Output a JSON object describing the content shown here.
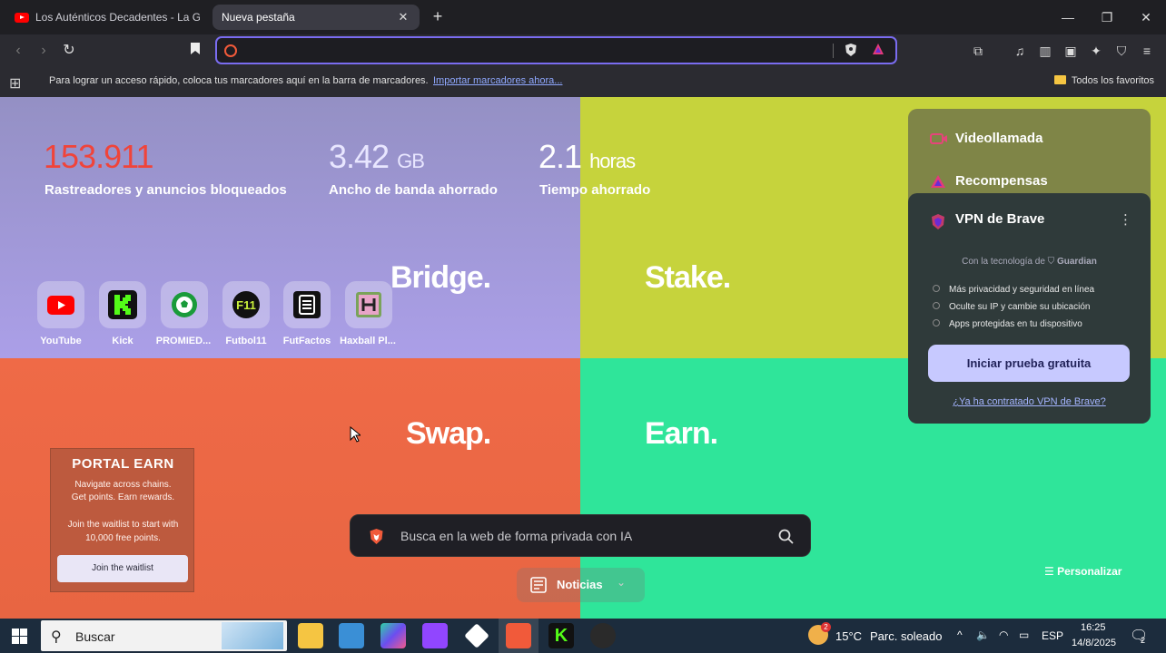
{
  "tabs": [
    {
      "title": "Los Auténticos Decadentes - La Guita",
      "favicon": "youtube-icon"
    },
    {
      "title": "Nueva pestaña"
    }
  ],
  "address": {
    "value": ""
  },
  "bookmarks_bar": {
    "message": "Para lograr un acceso rápido, coloca tus marcadores aquí en la barra de marcadores.",
    "import_link": "Importar marcadores ahora...",
    "all_favorites": "Todos los favoritos"
  },
  "stats": [
    {
      "value": "153.911",
      "unit": "",
      "label": "Rastreadores y anuncios bloqueados",
      "color": "#f0443a"
    },
    {
      "value": "3.42",
      "unit": "GB",
      "label": "Ancho de banda ahorrado",
      "color": "#e8e6ff"
    },
    {
      "value": "2.1",
      "unit": "horas",
      "label": "Tiempo ahorrado",
      "color": "#ffffff"
    }
  ],
  "promo_labels": {
    "bridge": "Bridge.",
    "stake": "Stake.",
    "swap": "Swap.",
    "earn": "Earn."
  },
  "top_sites": [
    {
      "label": "YouTube",
      "icon": "youtube-icon"
    },
    {
      "label": "Kick",
      "icon": "kick-icon"
    },
    {
      "label": "PROMIED...",
      "icon": "soccer-ball-icon"
    },
    {
      "label": "Futbol11",
      "icon": "futbol11-icon"
    },
    {
      "label": "FutFactos",
      "icon": "futfactos-icon"
    },
    {
      "label": "Haxball Pl...",
      "icon": "haxball-icon"
    }
  ],
  "sidebar_panel": {
    "videocall": "Videollamada",
    "rewards": "Recompensas",
    "vpn": {
      "title": "VPN de Brave",
      "powered_by": "Con la tecnología de",
      "provider": "Guardian",
      "features": [
        "Más privacidad y seguridad en línea",
        "Oculte su IP y cambie su ubicación",
        "Apps protegidas en tu dispositivo"
      ],
      "cta": "Iniciar prueba gratuita",
      "link": "¿Ya ha contratado VPN de Brave?"
    }
  },
  "portal_card": {
    "title": "PORTAL EARN",
    "line1": "Navigate across chains.",
    "line2": "Get points. Earn rewards.",
    "line3": "Join the waitlist to start with",
    "line4": "10,000 free points.",
    "button": "Join the waitlist"
  },
  "search": {
    "placeholder": "Busca en la web de forma privada con IA"
  },
  "news": {
    "label": "Noticias"
  },
  "customize": {
    "label": "Personalizar"
  },
  "taskbar": {
    "search_label": "Buscar",
    "weather_badge": "2",
    "weather": "15°C",
    "weather_desc": "Parc. soleado",
    "lang": "ESP",
    "time": "16:25",
    "date": "14/8/2025",
    "notif_count": "2"
  },
  "colors": {
    "accent": "#7a6cf0",
    "brave_orange": "#f15a3a"
  }
}
